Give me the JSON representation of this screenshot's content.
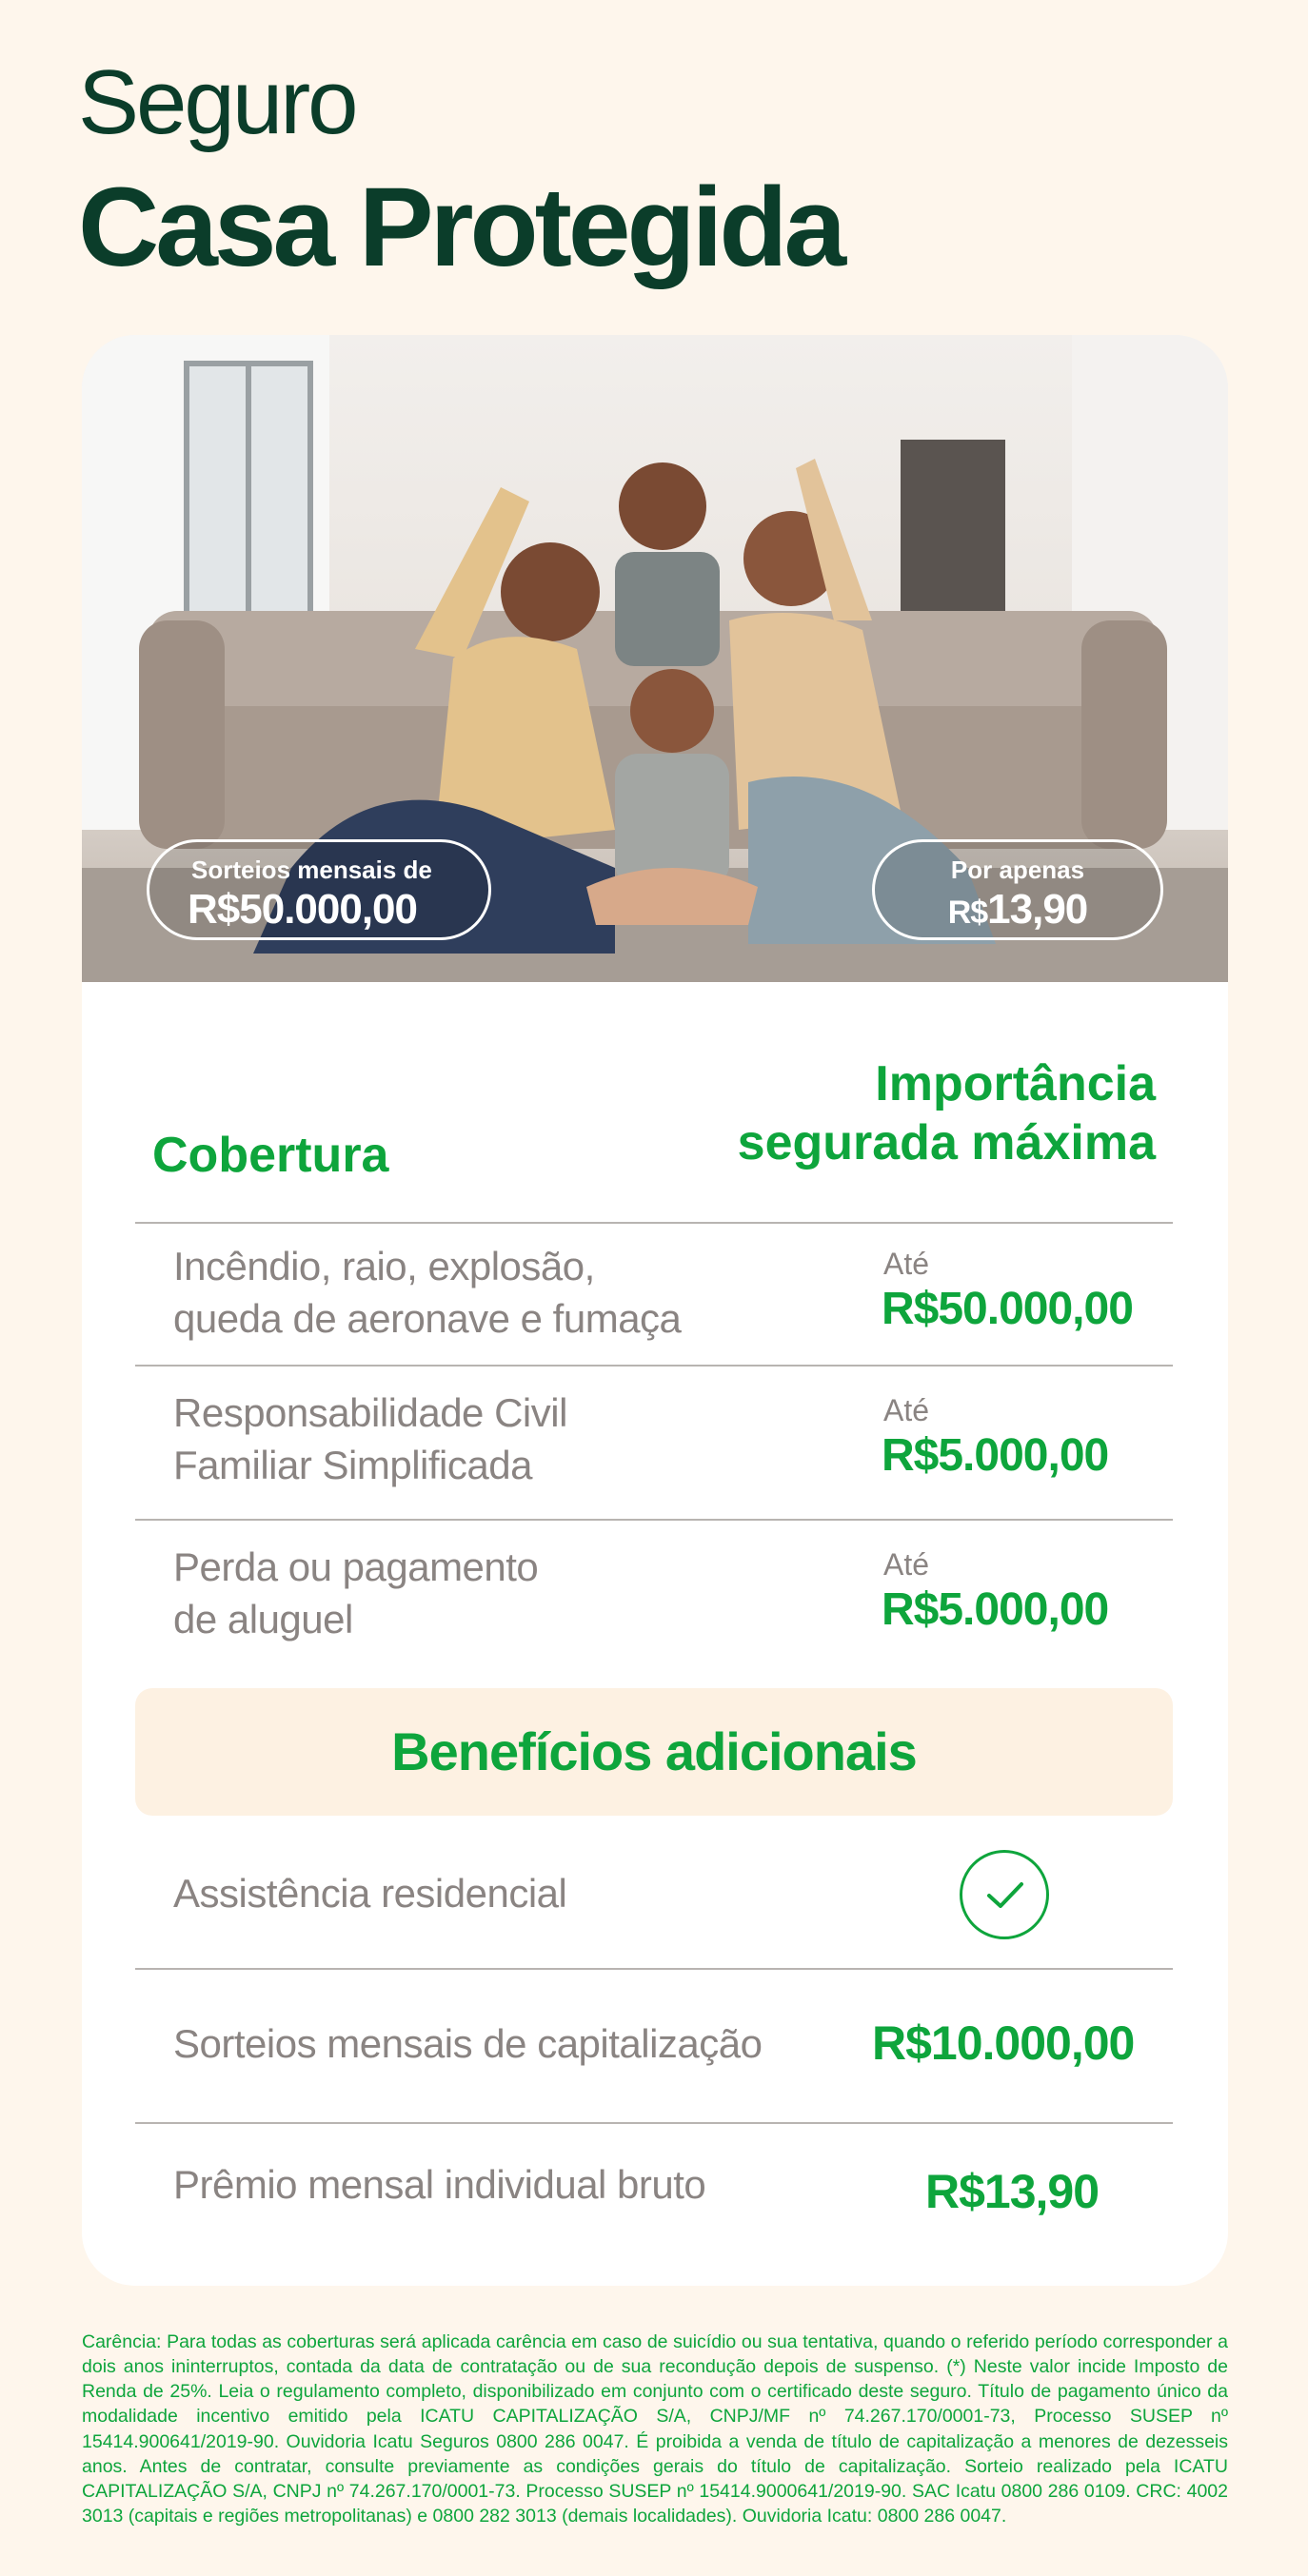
{
  "header": {
    "title_line1": "Seguro",
    "title_line2": "Casa Protegida"
  },
  "hero": {
    "left_pill": {
      "small": "Sorteios mensais de",
      "big": "R$50.000,00"
    },
    "right_pill": {
      "small": "Por apenas",
      "currency": "R$",
      "big": "13,90"
    }
  },
  "table": {
    "header_left": "Cobertura",
    "header_right_line1": "Importância",
    "header_right_line2": "segurada máxima",
    "rows": [
      {
        "label_line1": "Incêndio, raio, explosão,",
        "label_line2": "queda de aeronave e fumaça",
        "prefix": "Até",
        "value": "R$50.000,00"
      },
      {
        "label_line1": "Responsabilidade Civil",
        "label_line2": "Familiar Simplificada",
        "prefix": "Até",
        "value": "R$5.000,00"
      },
      {
        "label_line1": "Perda ou pagamento",
        "label_line2": "de aluguel",
        "prefix": "Até",
        "value": "R$5.000,00"
      }
    ]
  },
  "benefits": {
    "title": "Benefícios adicionais",
    "items": [
      {
        "label": "Assistência residencial",
        "icon": "check-circle-icon"
      },
      {
        "label": "Sorteios mensais de capitalização",
        "value": "R$10.000,00"
      },
      {
        "label": "Prêmio mensal  individual bruto",
        "value": "R$13,90"
      }
    ]
  },
  "disclaimer": "Carência: Para todas as coberturas será aplicada carência em caso de suicídio ou sua tentativa, quando o referido período corresponder a dois anos ininterruptos, contada da data de contratação ou de sua recondução depois de suspenso. (*) Neste valor incide Imposto de Renda de 25%. Leia o regulamento completo, disponibilizado em conjunto com o certificado deste seguro. Título de pagamento único da modalidade incentivo emitido pela ICATU CAPITALIZAÇÃO S/A, CNPJ/MF nº 74.267.170/0001-73, Processo SUSEP nº 15414.900641/2019-90. Ouvidoria Icatu Seguros 0800 286 0047. É proibida a venda de título de capitalização a menores de dezesseis anos. Antes de contratar, consulte previamente as condições gerais do título de capitalização. Sorteio realizado pela ICATU CAPITALIZAÇÃO S/A, CNPJ nº 74.267.170/0001-73. Processo SUSEP nº 15414.9000641/2019-90. SAC Icatu 0800 286 0109. CRC: 4002 3013 (capitais e regiões metropolitanas) e 0800 282 3013 (demais localidades). Ouvidoria Icatu: 0800 286 0047.",
  "colors": {
    "background": "#fef6ec",
    "title": "#0b3d2a",
    "accent_green": "#0ea53c",
    "muted_text": "#8a8482",
    "benefits_band": "#fdf1e2"
  }
}
